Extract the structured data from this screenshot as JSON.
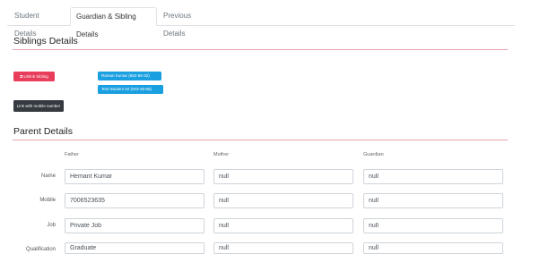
{
  "tabs": [
    {
      "label": "Student Details"
    },
    {
      "label": "Guardian & Sibling Details"
    },
    {
      "label": "Previous Details"
    }
  ],
  "siblings": {
    "title": "Siblings Details",
    "unlink_label": "Unlink Sibling",
    "link_mobile_label": "Link with mobile number",
    "badges": [
      {
        "label": "Raman Kumar (652-56-32)"
      },
      {
        "label": "Test Student 42 (023-36-56)"
      }
    ]
  },
  "parents": {
    "title": "Parent Details",
    "columns": [
      "Father",
      "Mother",
      "Guardian"
    ],
    "rows": [
      {
        "label": "Name",
        "father": "Hemant Kumar",
        "mother": "null",
        "guardian": "null"
      },
      {
        "label": "Mobile",
        "father": "7006523635",
        "mother": "null",
        "guardian": "null"
      },
      {
        "label": "Job",
        "father": "Private Job",
        "mother": "null",
        "guardian": "null"
      },
      {
        "label": "Qualification",
        "father": "Graduate",
        "mother": "null",
        "guardian": "null"
      }
    ]
  },
  "colors": {
    "accent_rule": "#e8a2b0",
    "danger": "#e83e5c",
    "info": "#1a9fe0",
    "dark": "#343a40"
  }
}
